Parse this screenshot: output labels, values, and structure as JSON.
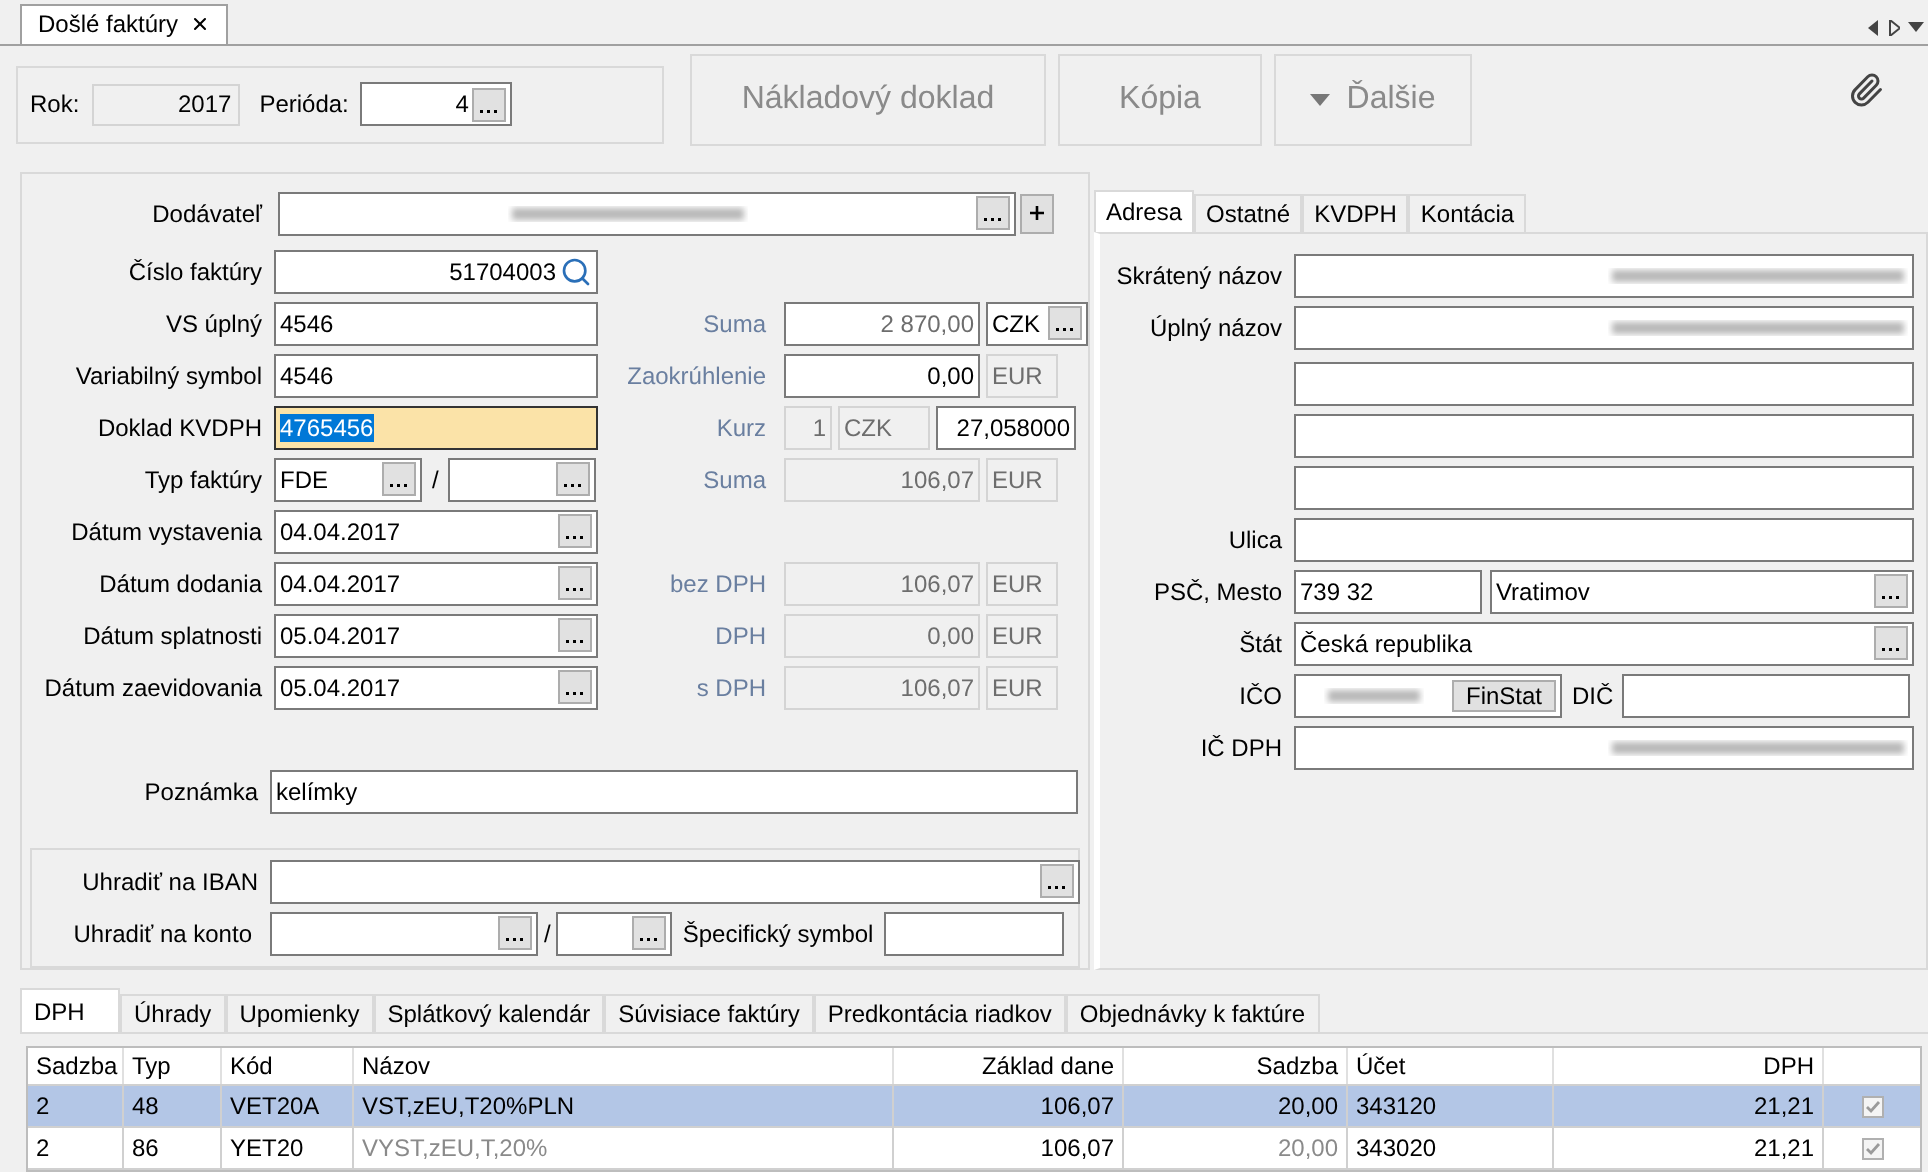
{
  "doc_tab": {
    "title": "Došlé faktúry"
  },
  "toolbar": {
    "rok_label": "Rok:",
    "rok": "2017",
    "perioda_label": "Perióda:",
    "perioda": "4",
    "buttons": [
      {
        "label": "Nákladový doklad",
        "kind": "plain",
        "disabled": true
      },
      {
        "label": "Kópia",
        "kind": "plain",
        "disabled": true
      },
      {
        "label": "Ďalšie",
        "kind": "dropdown",
        "disabled": true
      }
    ]
  },
  "supplier": {
    "label": "Dodávateľ",
    "redacted": true
  },
  "rows": [
    {
      "label": "Číslo faktúry",
      "value": "51704003",
      "kind": "search",
      "focused": false
    },
    {
      "label": "VS úplný",
      "value": "4546",
      "kind": "text",
      "focused": false,
      "right": {
        "label": "Suma",
        "value": "2 870,00",
        "currency": "CZK",
        "kind": "pick"
      }
    },
    {
      "label": "Variabilný symbol",
      "value": "4546",
      "kind": "text",
      "focused": false,
      "right": {
        "label": "Zaokrúhlenie",
        "value": "0,00",
        "currency": "EUR",
        "kind": "edit"
      }
    },
    {
      "label": "Doklad KVDPH",
      "value": "4765456",
      "kind": "text",
      "focused": true,
      "right": {
        "label": "Kurz",
        "amount": "1",
        "currency": "CZK",
        "value": "27,058000",
        "kind": "rate"
      }
    },
    {
      "label": "Typ faktúry",
      "value": "FDE",
      "separator": "/",
      "kind": "type",
      "focused": false,
      "right": {
        "label": "Suma",
        "value": "106,07",
        "currency": "EUR",
        "kind": "readonly"
      }
    },
    {
      "label": "Dátum vystavenia",
      "value": "04.04.2017",
      "kind": "date",
      "focused": false
    },
    {
      "label": "Dátum dodania",
      "value": "04.04.2017",
      "kind": "date",
      "focused": false,
      "right": {
        "label": "bez DPH",
        "value": "106,07",
        "currency": "EUR",
        "kind": "readonly"
      }
    },
    {
      "label": "Dátum splatnosti",
      "value": "05.04.2017",
      "kind": "date",
      "focused": false,
      "right": {
        "label": "DPH",
        "value": "0,00",
        "currency": "EUR",
        "kind": "readonly"
      }
    },
    {
      "label": "Dátum zaevidovania",
      "value": "05.04.2017",
      "kind": "date",
      "focused": false,
      "right": {
        "label": "s DPH",
        "value": "106,07",
        "currency": "EUR",
        "kind": "readonly"
      }
    }
  ],
  "note": {
    "label": "Poznámka",
    "value": "kelímky"
  },
  "payment": {
    "iban_label": "Uhradiť na IBAN",
    "konto_label": "Uhradiť na konto",
    "separator": "/",
    "specific_label": "Špecifický symbol"
  },
  "side_tabs": [
    {
      "label": "Adresa",
      "selected": true
    },
    {
      "label": "Ostatné",
      "selected": false
    },
    {
      "label": "KVDPH",
      "selected": false
    },
    {
      "label": "Kontácia",
      "selected": false
    }
  ],
  "address": [
    {
      "label": "Skrátený názov",
      "kind": "text",
      "redacted": true
    },
    {
      "label": "Úplný názov",
      "kind": "text",
      "redacted": true
    },
    {
      "kind": "text",
      "redacted": false
    },
    {
      "kind": "text",
      "redacted": false
    },
    {
      "kind": "text",
      "redacted": false
    },
    {
      "label": "Ulica",
      "kind": "text",
      "redacted": false
    },
    {
      "label": "PSČ, Mesto",
      "kind": "pair",
      "value": "739 32",
      "value2": "Vratimov"
    },
    {
      "label": "Štát",
      "kind": "browse",
      "value": "Česká republika"
    },
    {
      "label": "IČO",
      "kind": "ico",
      "redacted": true,
      "button": "FinStat",
      "label2": "DIČ"
    },
    {
      "label": "IČ DPH",
      "kind": "text",
      "redacted": true
    }
  ],
  "bottom_tabs": [
    {
      "label": "DPH",
      "selected": true
    },
    {
      "label": "Úhrady",
      "selected": false
    },
    {
      "label": "Upomienky",
      "selected": false
    },
    {
      "label": "Splátkový kalendár",
      "selected": false
    },
    {
      "label": "Súvisiace faktúry",
      "selected": false
    },
    {
      "label": "Predkontácia riadkov",
      "selected": false
    },
    {
      "label": "Objednávky k faktúre",
      "selected": false
    }
  ],
  "table": {
    "columns": [
      "Sadzba",
      "Typ",
      "Kód",
      "Názov",
      "Základ dane",
      "Sadzba",
      "Účet",
      "DPH"
    ],
    "rows": [
      {
        "cells": [
          "2",
          "48",
          "VET20A",
          "VST,zEU,T20%PLN",
          "106,07",
          "20,00",
          "343120",
          "21,21"
        ],
        "selected": true,
        "muted": false,
        "checked": true
      },
      {
        "cells": [
          "2",
          "86",
          "YET20",
          "VYST,zEU,T,20%",
          "106,07",
          "20,00",
          "343020",
          "21,21"
        ],
        "selected": false,
        "muted": true,
        "checked": true
      }
    ]
  }
}
